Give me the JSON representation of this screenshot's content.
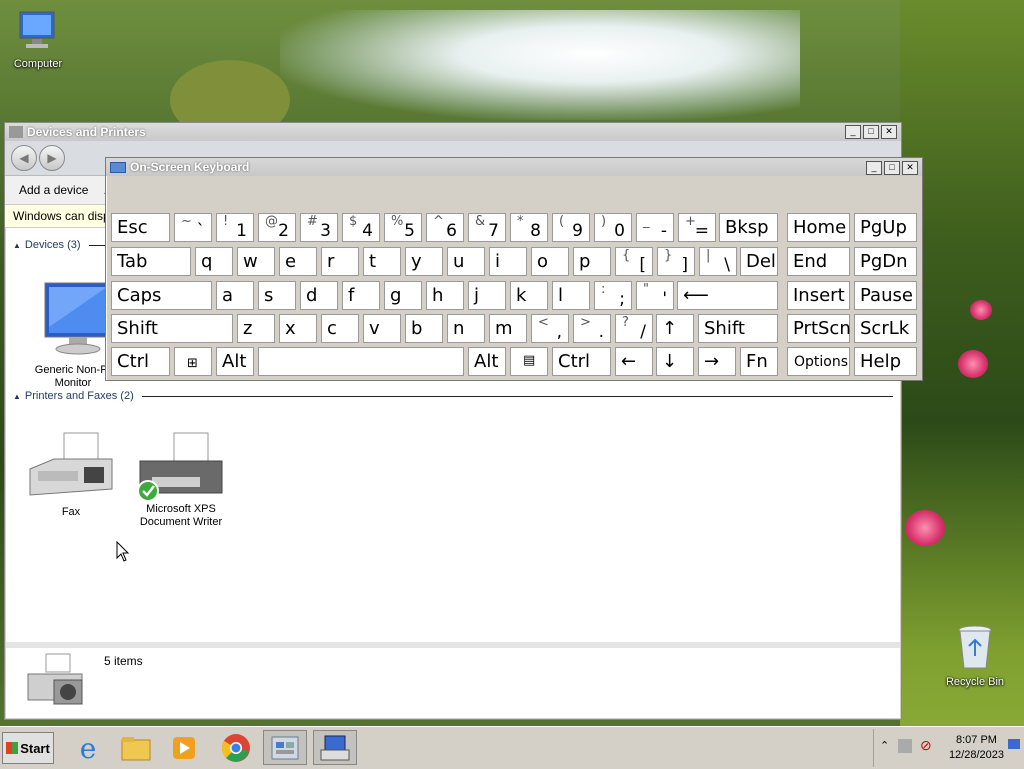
{
  "desktop": {
    "icons": [
      {
        "label": "Computer"
      },
      {
        "label": "Recycle Bin"
      }
    ]
  },
  "explorer": {
    "title": "Devices and Printers",
    "toolbar": {
      "add_device": "Add a device",
      "add_printer_partial": "A"
    },
    "infobar": "Windows can displa",
    "groups": {
      "devices": "Devices (3)",
      "printers": "Printers and Faxes (2)"
    },
    "devices": [
      {
        "label": "Generic Non-Pr\nMonitor"
      }
    ],
    "printers": [
      {
        "label": "Fax"
      },
      {
        "label": "Microsoft XPS\nDocument Writer"
      }
    ],
    "status": {
      "items": "5 items"
    }
  },
  "osk": {
    "title": "On-Screen Keyboard",
    "keys": {
      "esc": "Esc",
      "bksp": "Bksp",
      "home": "Home",
      "pgup": "PgUp",
      "tab": "Tab",
      "del": "Del",
      "end": "End",
      "pgdn": "PgDn",
      "caps": "Caps",
      "insert": "Insert",
      "pause": "Pause",
      "shift": "Shift",
      "prtscn": "PrtScn",
      "scrlk": "ScrLk",
      "ctrl": "Ctrl",
      "alt": "Alt",
      "fn": "Fn",
      "options": "Options",
      "help": "Help"
    },
    "row1": [
      {
        "up": "~",
        "low": "`"
      },
      {
        "up": "!",
        "low": "1"
      },
      {
        "up": "@",
        "low": "2"
      },
      {
        "up": "#",
        "low": "3"
      },
      {
        "up": "$",
        "low": "4"
      },
      {
        "up": "%",
        "low": "5"
      },
      {
        "up": "^",
        "low": "6"
      },
      {
        "up": "&",
        "low": "7"
      },
      {
        "up": "*",
        "low": "8"
      },
      {
        "up": "(",
        "low": "9"
      },
      {
        "up": ")",
        "low": "0"
      },
      {
        "up": "_",
        "low": "-"
      },
      {
        "up": "+",
        "low": "="
      }
    ],
    "row2": [
      "q",
      "w",
      "e",
      "r",
      "t",
      "y",
      "u",
      "i",
      "o",
      "p"
    ],
    "row2_sym": [
      {
        "up": "{",
        "low": "["
      },
      {
        "up": "}",
        "low": "]"
      },
      {
        "up": "|",
        "low": "\\"
      }
    ],
    "row3": [
      "a",
      "s",
      "d",
      "f",
      "g",
      "h",
      "j",
      "k",
      "l"
    ],
    "row3_sym": [
      {
        "up": ":",
        "low": ";"
      },
      {
        "up": "\"",
        "low": "'"
      }
    ],
    "row4": [
      "z",
      "x",
      "c",
      "v",
      "b",
      "n",
      "m"
    ],
    "row4_sym": [
      {
        "up": "<",
        "low": ","
      },
      {
        "up": ">",
        "low": "."
      },
      {
        "up": "?",
        "low": "/"
      }
    ],
    "arrows": {
      "up": "↑",
      "left": "←",
      "down": "↓",
      "right": "→",
      "enter": "⟵"
    }
  },
  "taskbar": {
    "start": "Start",
    "clock": {
      "time": "8:07 PM",
      "date": "12/28/2023"
    }
  }
}
